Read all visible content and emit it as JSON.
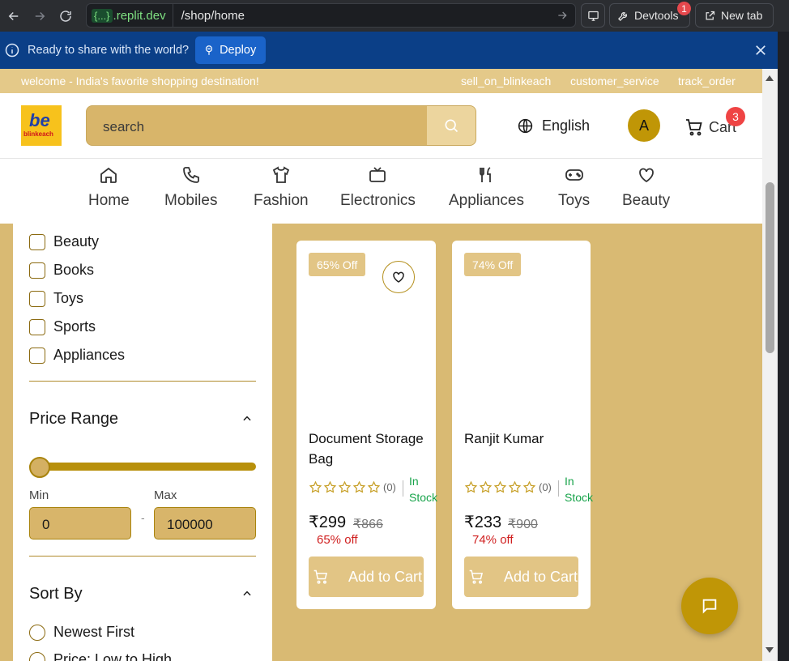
{
  "browser": {
    "domain_braces": "{...}",
    "domain": ".replit.dev",
    "path": "/shop/home",
    "devtools_label": "Devtools",
    "devtools_badge": "1",
    "newtab_label": "New tab"
  },
  "deploy_bar": {
    "message": "Ready to share with the world?",
    "button": "Deploy"
  },
  "topstrip": {
    "welcome": "welcome - India's favorite shopping destination!",
    "links": [
      "sell_on_blinkeach",
      "customer_service",
      "track_order"
    ]
  },
  "header": {
    "logo_text": "blinkeach",
    "search_placeholder": "search",
    "language": "English",
    "avatar_initial": "A",
    "cart_label": "Cart",
    "cart_count": "3"
  },
  "categories": [
    "Home",
    "Mobiles",
    "Fashion",
    "Electronics",
    "Appliances",
    "Toys",
    "Beauty"
  ],
  "filters": {
    "category_options": [
      "Beauty",
      "Books",
      "Toys",
      "Sports",
      "Appliances"
    ],
    "price_title": "Price Range",
    "min_label": "Min",
    "max_label": "Max",
    "min_value": "0",
    "max_value": "100000",
    "range_dash": "-",
    "sort_title": "Sort By",
    "sort_options": [
      "Newest First",
      "Price: Low to High"
    ]
  },
  "products": [
    {
      "discount_tag": "65% Off",
      "name": "Document Storage Bag",
      "rating_count": "(0)",
      "stock": "In Stock",
      "price": "₹299",
      "mrp": "₹866",
      "off": "65% off",
      "button": "Add to Cart"
    },
    {
      "discount_tag": "74% Off",
      "name": "Ranjit Kumar",
      "rating_count": "(0)",
      "stock": "In Stock",
      "price": "₹233",
      "mrp": "₹900",
      "off": "74% off",
      "button": "Add to Cart"
    }
  ],
  "colors": {
    "brand_gold": "#c09606",
    "page_bg": "#d9ba73",
    "accent_light": "#e2c585",
    "deploy_bar": "#0b3f87",
    "stock_green": "#17a34a",
    "off_red": "#d02020"
  }
}
